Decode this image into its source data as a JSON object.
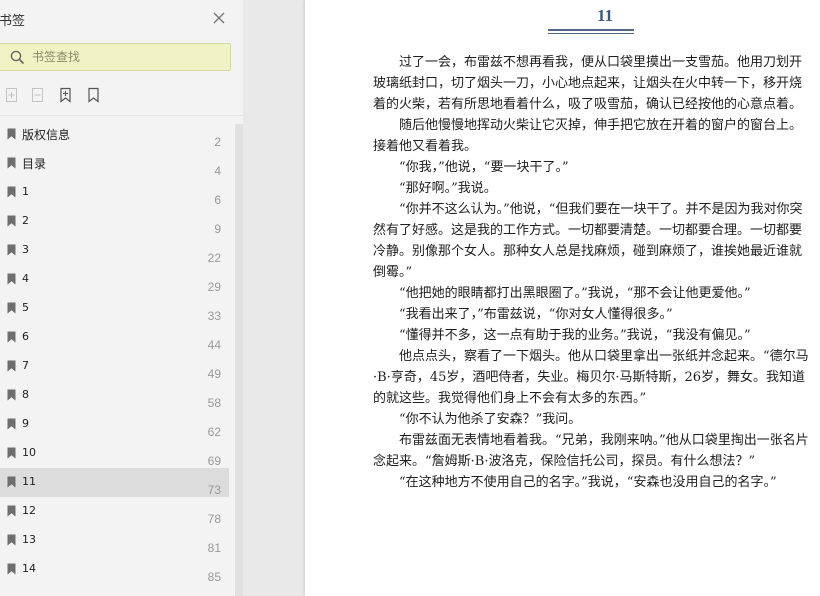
{
  "sidebar": {
    "title": "书签",
    "search": {
      "placeholder": "书签查找",
      "value": ""
    },
    "toolbar": {
      "icons": [
        "add-bookmark-icon",
        "delete-bookmark-icon",
        "bookmark-icon",
        "bookmark-outline-icon"
      ]
    },
    "bookmarks": [
      {
        "label": "版权信息",
        "page": "2"
      },
      {
        "label": "目录",
        "page": "4"
      },
      {
        "label": "1",
        "page": "6"
      },
      {
        "label": "2",
        "page": "9"
      },
      {
        "label": "3",
        "page": "22"
      },
      {
        "label": "4",
        "page": "29"
      },
      {
        "label": "5",
        "page": "33"
      },
      {
        "label": "6",
        "page": "44"
      },
      {
        "label": "7",
        "page": "49"
      },
      {
        "label": "8",
        "page": "58"
      },
      {
        "label": "9",
        "page": "62"
      },
      {
        "label": "10",
        "page": "69"
      },
      {
        "label": "11",
        "page": "73"
      },
      {
        "label": "12",
        "page": "78"
      },
      {
        "label": "13",
        "page": "81"
      },
      {
        "label": "14",
        "page": "85"
      }
    ],
    "active_index": 12
  },
  "document": {
    "chapter_number": "11",
    "paragraphs": [
      "过了一会，布雷兹不想再看我，便从口袋里摸出一支雪茄。他用刀划开玻璃纸封口，切了烟头一刀，小心地点起来，让烟头在火中转一下，移开烧着的火柴，若有所思地看着什么，吸了吸雪茄，确认已经按他的心意点着。",
      "随后他慢慢地挥动火柴让它灭掉，伸手把它放在开着的窗户的窗台上。接着他又看着我。",
      "“你我，”他说，“要一块干了。”",
      "“那好啊。”我说。",
      "“你并不这么认为。”他说，“但我们要在一块干了。并不是因为我对你突然有了好感。这是我的工作方式。一切都要清楚。一切都要合理。一切都要冷静。别像那个女人。那种女人总是找麻烦，碰到麻烦了，谁挨她最近谁就倒霉。”",
      "“他把她的眼睛都打出黑眼圈了。”我说，“那不会让他更爱他。”",
      "“我看出来了，”布雷兹说，“你对女人懂得很多。”",
      "“懂得并不多，这一点有助于我的业务。”我说，“我没有偏见。”",
      "他点点头，察看了一下烟头。他从口袋里拿出一张纸并念起来。“德尔马·B·亨奇，45岁，酒吧侍者，失业。梅贝尔·马斯特斯，26岁，舞女。我知道的就这些。我觉得他们身上不会有太多的东西。”",
      "“你不认为他杀了安森？”我问。",
      "布雷兹面无表情地看着我。“兄弟，我刚来呐。”他从口袋里掏出一张名片念起来。“詹姆斯·B·波洛克，保险信托公司，探员。有什么想法？”",
      "“在这种地方不使用自己的名字。”我说，“安森也没用自己的名字。”"
    ]
  }
}
